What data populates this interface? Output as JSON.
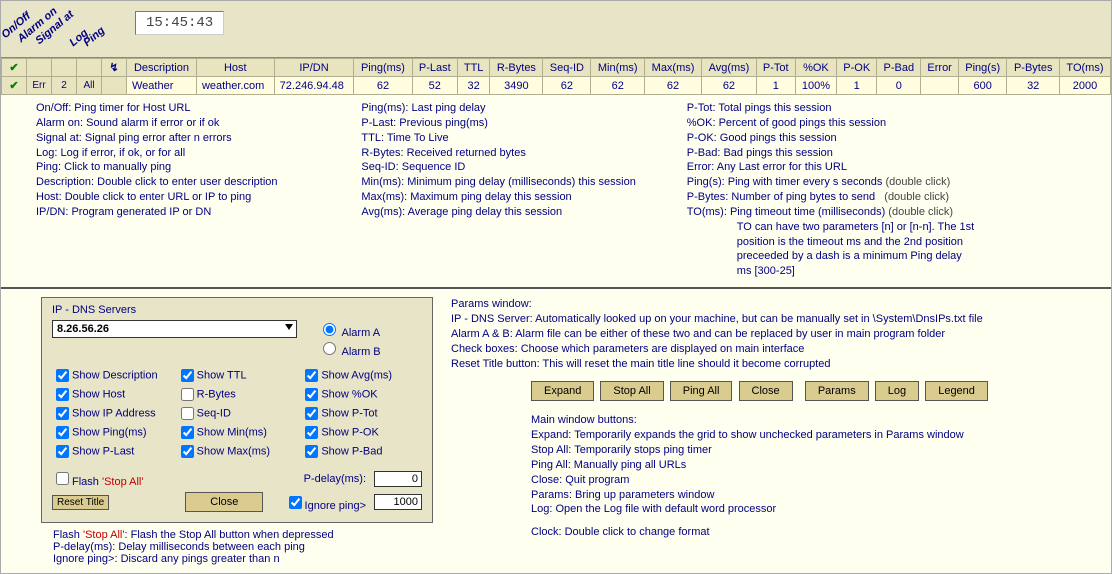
{
  "clock": "15:45:43",
  "diagonals": [
    "On/Off",
    "Alarm on",
    "Signal at",
    "Log",
    "Ping"
  ],
  "columns": {
    "col_desc": "Description",
    "col_host": "Host",
    "col_ipdn": "IP/DN",
    "col_ping": "Ping(ms)",
    "col_plast": "P-Last",
    "col_ttl": "TTL",
    "col_rbytes": "R-Bytes",
    "col_seqid": "Seq-ID",
    "col_min": "Min(ms)",
    "col_max": "Max(ms)",
    "col_avg": "Avg(ms)",
    "col_ptot": "P-Tot",
    "col_pok_pct": "%OK",
    "col_pok": "P-OK",
    "col_pbad": "P-Bad",
    "col_error": "Error",
    "col_pings": "Ping(s)",
    "col_pbytes": "P-Bytes",
    "col_to": "TO(ms)",
    "col_err": "Err",
    "col_2": "2",
    "col_all": "All"
  },
  "row": {
    "desc": "Weather",
    "host": "weather.com",
    "ipdn": "72.246.94.48",
    "ping": "62",
    "plast": "52",
    "ttl": "32",
    "rbytes": "3490",
    "seqid": "62",
    "min": "62",
    "max": "62",
    "avg": "62",
    "ptot": "1",
    "pok_pct": "100%",
    "pok": "1",
    "pbad": "0",
    "error": "",
    "pings": "600",
    "pbytes": "32",
    "to": "2000"
  },
  "help1": [
    "On/Off: Ping timer for Host URL",
    "Alarm on: Sound alarm if error or if ok",
    "Signal at: Signal ping error after n errors",
    "Log: Log if error, if ok, or for all",
    "Ping: Click to manually ping",
    "Description: Double click to enter user description",
    "Host: Double click to enter URL or IP to ping",
    "IP/DN: Program generated IP or DN"
  ],
  "help2": [
    "Ping(ms): Last ping delay",
    "P-Last: Previous ping(ms)",
    "TTL: Time To Live",
    "R-Bytes: Received returned bytes",
    "Seq-ID: Sequence ID",
    "Min(ms): Minimum ping delay (milliseconds) this session",
    "Max(ms): Maximum ping delay this session",
    "Avg(ms): Average ping delay this session"
  ],
  "help3": [
    "P-Tot: Total pings this session",
    "%OK: Percent of good pings this session",
    "P-OK: Good pings this session",
    "P-Bad: Bad pings this session",
    "Error: Any Last error for this URL"
  ],
  "help3b": [
    "Ping(s): Ping with timer every s seconds",
    "P-Bytes: Number of ping bytes to send",
    "TO(ms): Ping timeout time (milliseconds)"
  ],
  "dbl": "(double click)",
  "to_extra": [
    "TO can have two parameters [n] or [n-n]. The 1st",
    "position is the timeout ms and the 2nd position",
    "preceeded by a dash is a minimum Ping delay",
    "ms [300-25]"
  ],
  "params": {
    "title": "IP - DNS Servers",
    "dns": "8.26.56.26",
    "alarmA": "Alarm A",
    "alarmB": "Alarm B",
    "c": {
      "desc": "Show Description",
      "host": "Show Host",
      "ip": "Show IP Address",
      "ping": "Show Ping(ms)",
      "plast": "Show P-Last",
      "ttl": "Show TTL",
      "rbytes": "R-Bytes",
      "seqid": "Seq-ID",
      "min": "Show Min(ms)",
      "max": "Show Max(ms)",
      "avg": "Show Avg(ms)",
      "pokpct": "Show %OK",
      "ptot": "Show P-Tot",
      "pok": "Show P-OK",
      "pbad": "Show P-Bad"
    },
    "flash_pre": "Flash ",
    "flash_stop": "'Stop All'",
    "pdelay_lbl": "P-delay(ms):",
    "pdelay_val": "0",
    "ignore_lbl": "Ignore ping>",
    "ignore_val": "1000",
    "reset": "Reset Title",
    "close": "Close"
  },
  "flash_help": "Flash 'Stop All': Flash the Stop All button when depressed",
  "flash_help_pre": "Flash ",
  "flash_help_stop": "'Stop All'",
  "flash_help_rest": ": Flash the Stop All button when depressed",
  "pdelay_help": "P-delay(ms): Delay milliseconds between each ping",
  "ignore_help": "Ignore ping>: Discard any pings greater than n",
  "rhelp": {
    "title": "Params window:",
    "l1": "IP - DNS Server: Automatically looked up on your machine, but can be manually set in \\System\\DnsIPs.txt file",
    "l2": "Alarm A & B: Alarm file can be either of these two and can be replaced by user in main program folder",
    "l3": "Check boxes: Choose which parameters are displayed on main interface",
    "l4": "Reset Title button: This will reset the main title line should it become corrupted",
    "btns": {
      "expand": "Expand",
      "stopall": "Stop All",
      "pingall": "Ping All",
      "close": "Close",
      "params": "Params",
      "log": "Log",
      "legend": "Legend"
    },
    "mtitle": "Main window buttons:",
    "m1": "Expand: Temporarily expands the grid to show unchecked parameters in Params window",
    "m2": "Stop All: Temporarily stops ping timer",
    "m3": "Ping All: Manually ping all URLs",
    "m4": "Close: Quit program",
    "m5": "Params: Bring up parameters window",
    "m6": "Log: Open the Log file with default word processor",
    "clock": "Clock: Double click to change format"
  }
}
